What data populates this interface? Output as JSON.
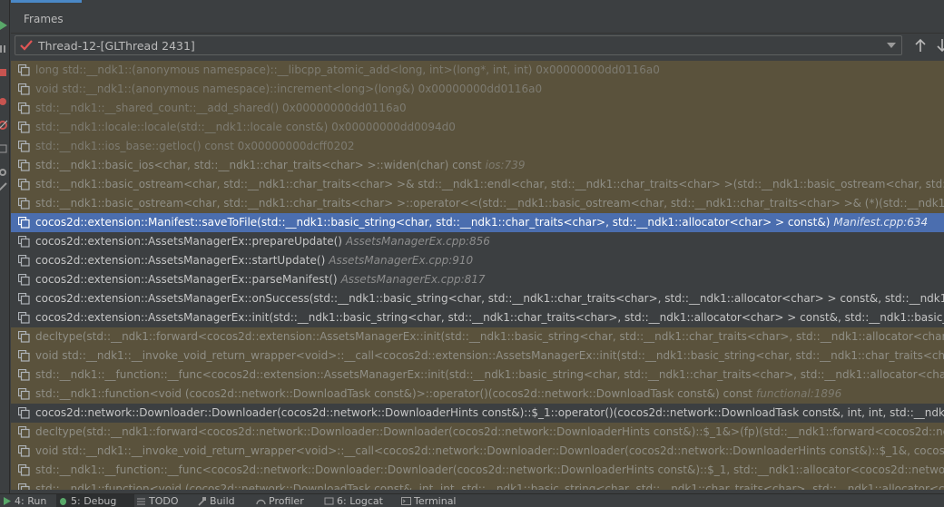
{
  "panel": {
    "title": "Frames",
    "thread": "Thread-12-[GLThread 2431]"
  },
  "frames": [
    {
      "text": "long std::__ndk1::(anonymous namespace)::__libcpp_atomic_add<long, int>(long*, int, int) 0x00000000dd0116a0",
      "file": "",
      "kind": "lib dim"
    },
    {
      "text": "void std::__ndk1::(anonymous namespace)::increment<long>(long&) 0x00000000dd0116a0",
      "file": "",
      "kind": "lib dim"
    },
    {
      "text": "std::__ndk1::__shared_count::__add_shared() 0x00000000dd0116a0",
      "file": "",
      "kind": "lib dim"
    },
    {
      "text": "std::__ndk1::locale::locale(std::__ndk1::locale const&) 0x00000000dd0094d0",
      "file": "",
      "kind": "lib dim"
    },
    {
      "text": "std::__ndk1::ios_base::getloc() const 0x00000000dcff0202",
      "file": "",
      "kind": "lib dim"
    },
    {
      "text": "std::__ndk1::basic_ios<char, std::__ndk1::char_traits<char> >::widen(char) const",
      "file": "ios:739",
      "kind": "lib"
    },
    {
      "text": "std::__ndk1::basic_ostream<char, std::__ndk1::char_traits<char> >& std::__ndk1::endl<char, std::__ndk1::char_traits<char> >(std::__ndk1::basic_ostream<char, std::__ndk1::char",
      "file": "",
      "kind": "lib"
    },
    {
      "text": "std::__ndk1::basic_ostream<char, std::__ndk1::char_traits<char> >::operator<<(std::__ndk1::basic_ostream<char, std::__ndk1::char_traits<char> >& (*)(std::__ndk1::basic_ostrea",
      "file": "",
      "kind": "lib"
    },
    {
      "text": "cocos2d::extension::Manifest::saveToFile(std::__ndk1::basic_string<char, std::__ndk1::char_traits<char>, std::__ndk1::allocator<char> > const&)",
      "file": "Manifest.cpp:634",
      "kind": "sel"
    },
    {
      "text": "cocos2d::extension::AssetsManagerEx::prepareUpdate()",
      "file": "AssetsManagerEx.cpp:856",
      "kind": "normal"
    },
    {
      "text": "cocos2d::extension::AssetsManagerEx::startUpdate()",
      "file": "AssetsManagerEx.cpp:910",
      "kind": "normal"
    },
    {
      "text": "cocos2d::extension::AssetsManagerEx::parseManifest()",
      "file": "AssetsManagerEx.cpp:817",
      "kind": "normal"
    },
    {
      "text": "cocos2d::extension::AssetsManagerEx::onSuccess(std::__ndk1::basic_string<char, std::__ndk1::char_traits<char>, std::__ndk1::allocator<char> > const&, std::__ndk1::basic_strin",
      "file": "",
      "kind": "normal"
    },
    {
      "text": "cocos2d::extension::AssetsManagerEx::init(std::__ndk1::basic_string<char, std::__ndk1::char_traits<char>, std::__ndk1::allocator<char> > const&, std::__ndk1::basic_string<char",
      "file": "",
      "kind": "normal"
    },
    {
      "text": "decltype(std::__ndk1::forward<cocos2d::extension::AssetsManagerEx::init(std::__ndk1::basic_string<char, std::__ndk1::char_traits<char>, std::__ndk1::allocator<char> > const&",
      "file": "",
      "kind": "lib"
    },
    {
      "text": "void std::__ndk1::__invoke_void_return_wrapper<void>::__call<cocos2d::extension::AssetsManagerEx::init(std::__ndk1::basic_string<char, std::__ndk1::char_traits<char>, std::__ndk",
      "file": "",
      "kind": "lib"
    },
    {
      "text": "std::__ndk1::__function::__func<cocos2d::extension::AssetsManagerEx::init(std::__ndk1::basic_string<char, std::__ndk1::char_traits<char>, std::__ndk1::allocator<char> > const&,",
      "file": "",
      "kind": "lib"
    },
    {
      "text": "std::__ndk1::function<void (cocos2d::network::DownloadTask const&)>::operator()(cocos2d::network::DownloadTask const&) const",
      "file": "functional:1896",
      "kind": "lib"
    },
    {
      "text": "cocos2d::network::Downloader::Downloader(cocos2d::network::DownloaderHints const&)::$_1::operator()(cocos2d::network::DownloadTask const&, int, int, std::__ndk1::basic_s",
      "file": "",
      "kind": "normal"
    },
    {
      "text": "decltype(std::__ndk1::forward<cocos2d::network::Downloader::Downloader(cocos2d::network::DownloaderHints const&)::$_1&>(fp)(std::__ndk1::forward<cocos2d::network::Download",
      "file": "",
      "kind": "lib"
    },
    {
      "text": "void std::__ndk1::__invoke_void_return_wrapper<void>::__call<cocos2d::network::Downloader::Downloader(cocos2d::network::DownloaderHints const&)::$_1&, cocos2d::netwo",
      "file": "",
      "kind": "lib"
    },
    {
      "text": "std::__ndk1::__function::__func<cocos2d::network::Downloader::Downloader(cocos2d::network::DownloaderHints const&)::$_1, std::__ndk1::allocator<cocos2d::network::Downlo",
      "file": "",
      "kind": "lib"
    },
    {
      "text": "std::__ndk1::function<void (cocos2d::network::DownloadTask const&, int, int, std::__ndk1::basic_string<char, std::__ndk1::char_traits<char>, std::__ndk1::allocator<char> > const&",
      "file": "",
      "kind": "lib"
    }
  ],
  "bottom_bar": {
    "run": "4: Run",
    "debug": "5: Debug",
    "todo": "TODO",
    "build": "Build",
    "profiler": "Profiler",
    "logcat": "6: Logcat",
    "terminal": "Terminal"
  },
  "colors": {
    "selected_row": "#4b6eaf",
    "library_row": "#5a523c",
    "panel_bg": "#3c3f41"
  }
}
